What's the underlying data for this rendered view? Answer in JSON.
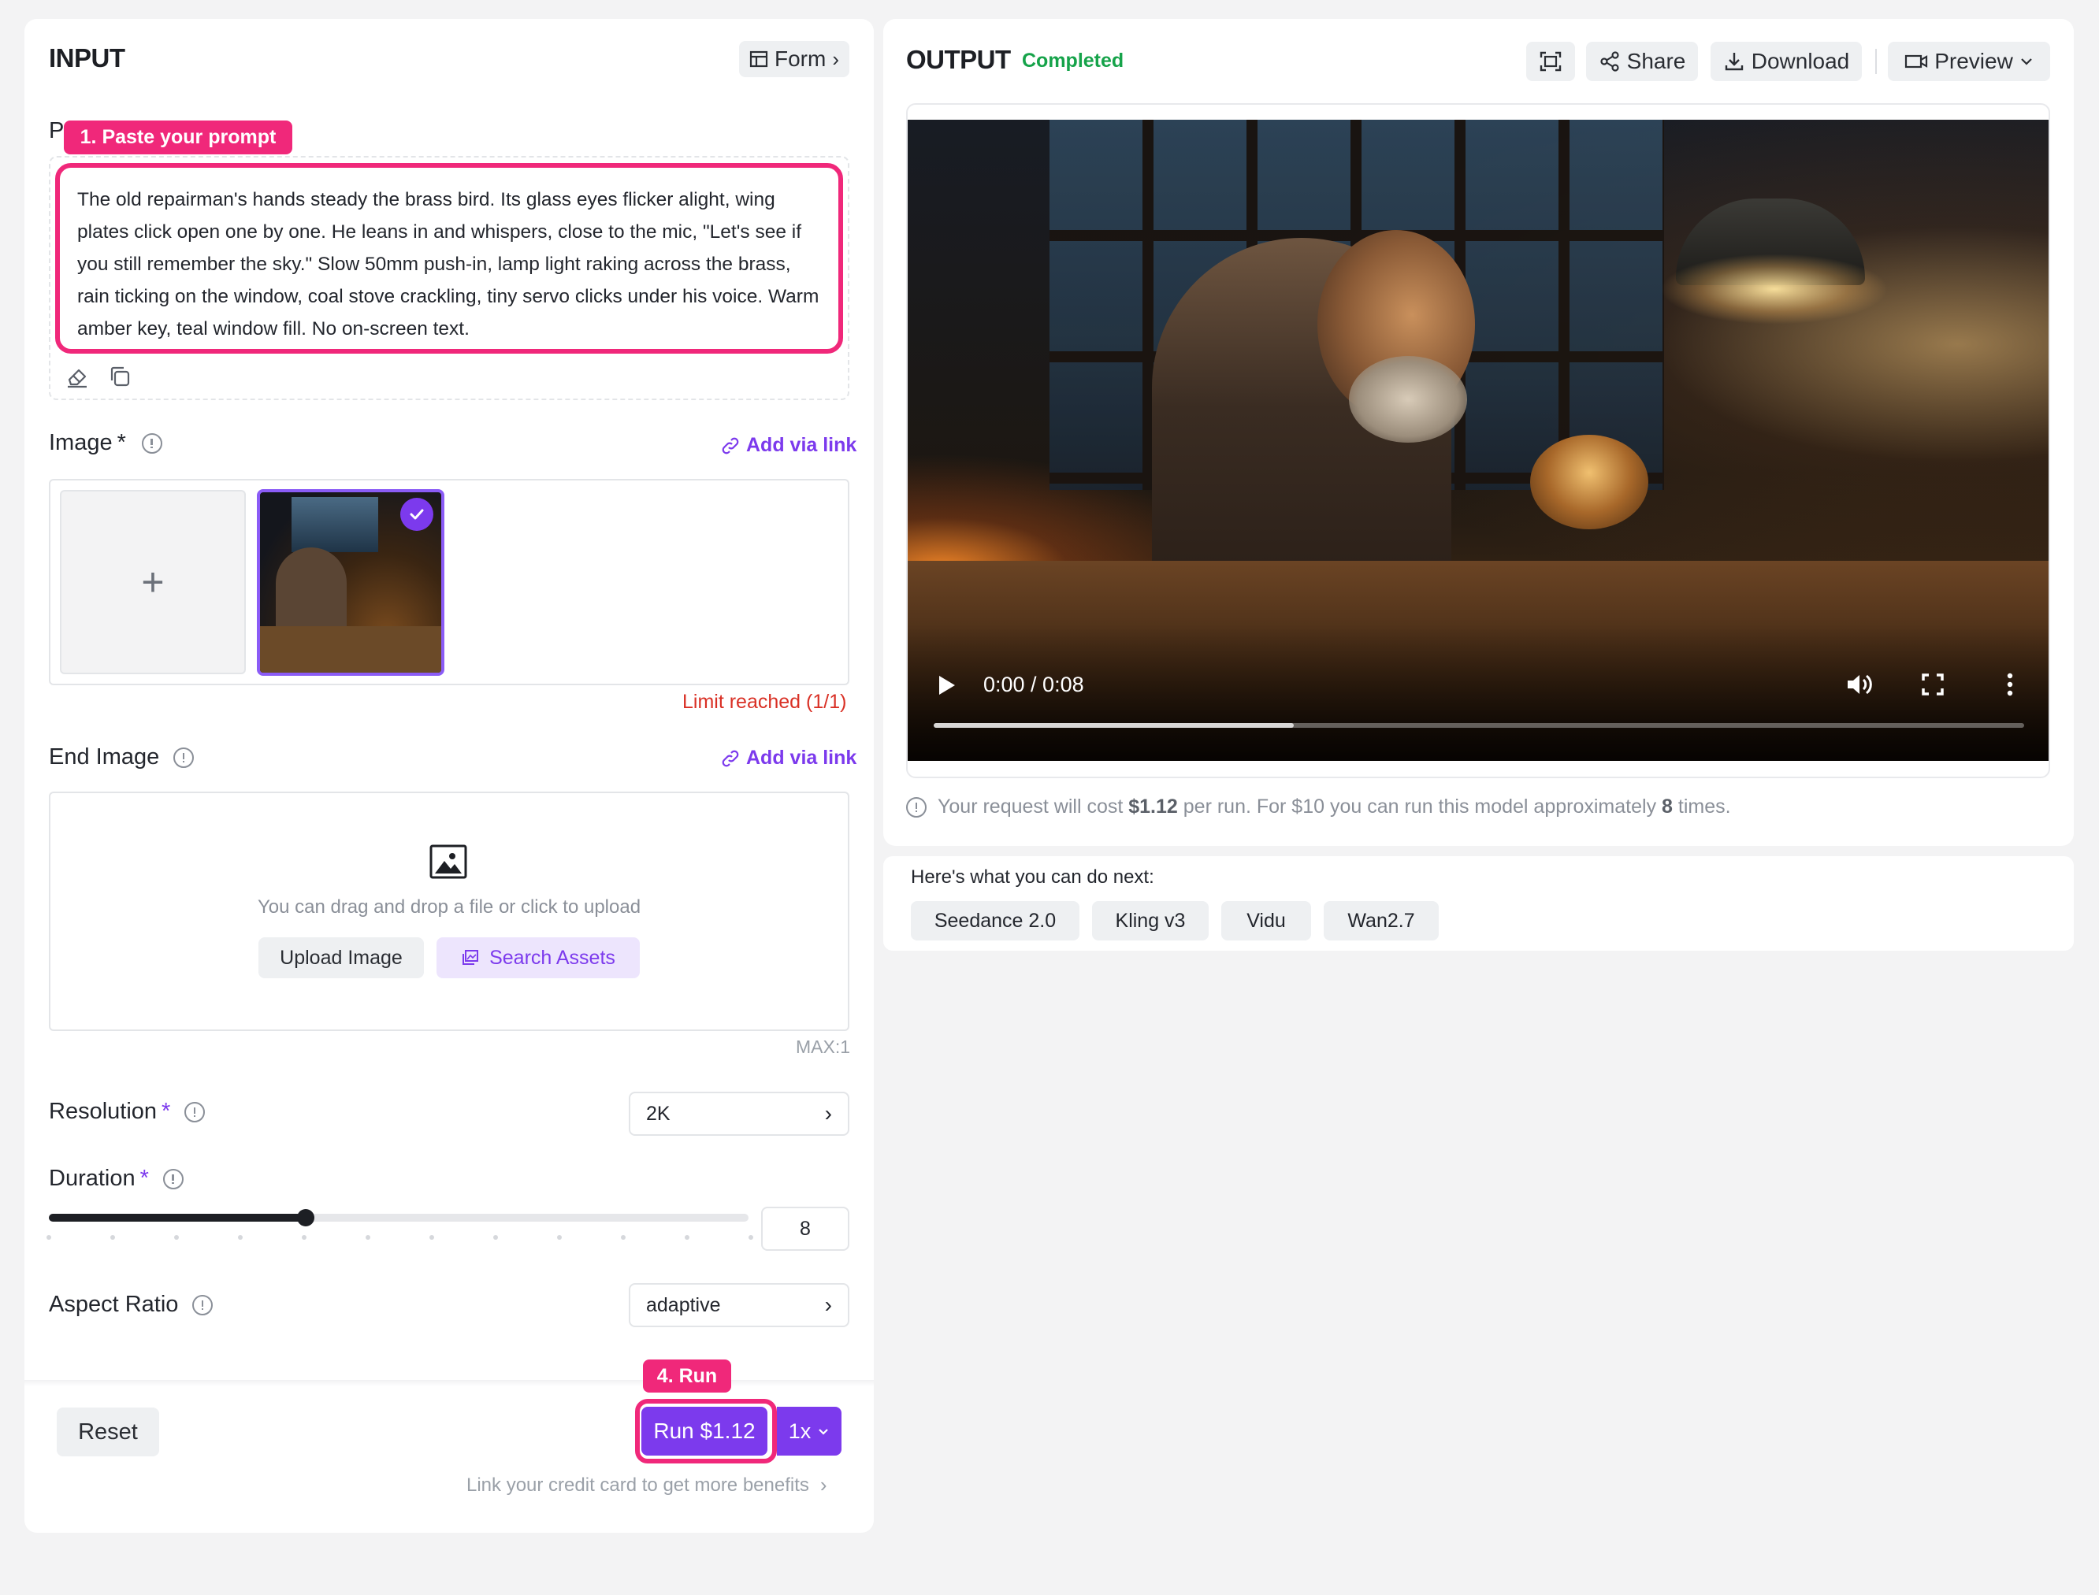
{
  "input": {
    "title": "INPUT",
    "form_button": "Form",
    "prompt_label_partial": "P",
    "prompt_text": "The old repairman's hands steady the brass bird. Its glass eyes flicker alight, wing plates click open one by one. He leans in and whispers, close to the mic, \"Let's see if you still remember the sky.\" Slow 50mm push-in, lamp light raking across the brass, rain ticking on the window, coal stove crackling, tiny servo clicks under his voice. Warm amber key, teal window fill. No on-screen text.",
    "image_label": "Image",
    "required_mark": "*",
    "add_via_link": "Add via link",
    "limit_reached": "Limit reached (1/1)",
    "end_image_label": "End Image",
    "upload_hint": "You can drag and drop a file or click to upload",
    "upload_button": "Upload Image",
    "search_assets": "Search Assets",
    "max_note": "MAX:1",
    "resolution_label": "Resolution",
    "resolution_value": "2K",
    "duration_label": "Duration",
    "duration_value": "8",
    "duration_fraction": 0.3667,
    "aspect_label": "Aspect Ratio",
    "aspect_value": "adaptive",
    "reset_button": "Reset",
    "run_button": "Run $1.12",
    "multiplier": "1x",
    "credit_link": "Link your credit card to get more benefits"
  },
  "annotations": {
    "step1": "1. Paste your prompt",
    "step4": "4. Run"
  },
  "output": {
    "title": "OUTPUT",
    "status": "Completed",
    "share": "Share",
    "download": "Download",
    "preview": "Preview",
    "video_time": "0:00 / 0:08",
    "video_progress": 0.33,
    "cost_prefix": "Your request will cost ",
    "cost_price": "$1.12",
    "cost_mid": " per run. For $10 you can run this model approximately ",
    "cost_count": "8",
    "cost_suffix": " times."
  },
  "next": {
    "heading": "Here's what you can do next:",
    "models": [
      "Seedance 2.0",
      "Kling v3",
      "Vidu",
      "Wan2.7"
    ]
  },
  "colors": {
    "accent": "#7c3aed",
    "annotation": "#f0287a",
    "status_green": "#16a34a",
    "error_red": "#d93025"
  }
}
